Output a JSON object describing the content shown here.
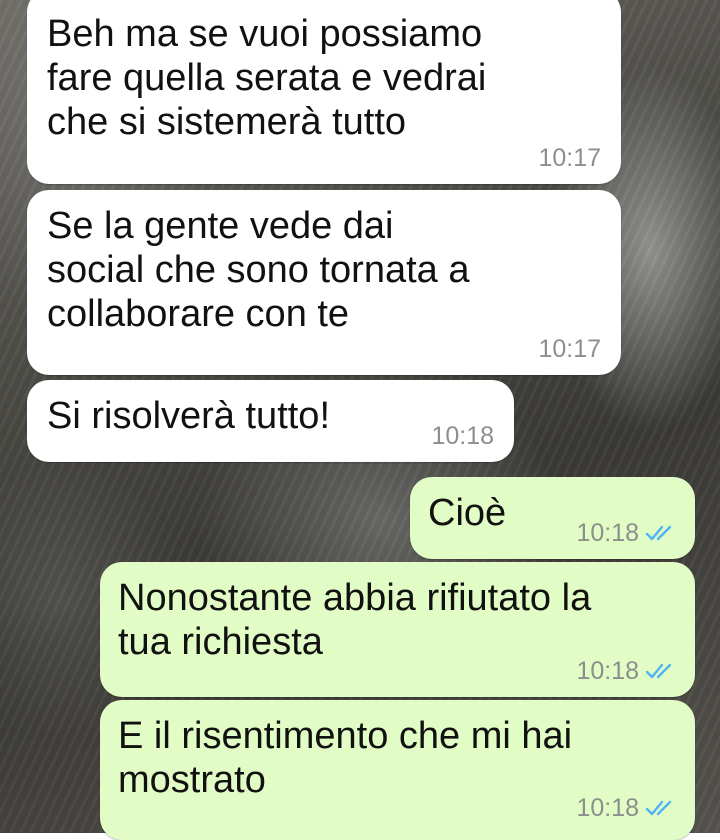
{
  "chat": {
    "messages": [
      {
        "direction": "incoming",
        "text": "Beh ma se vuoi possiamo\nfare quella serata e vedrai\nche si sistemerà tutto",
        "time": "10:17"
      },
      {
        "direction": "incoming",
        "text": "Se la gente vede dai\nsocial che sono tornata a\ncollaborare con te",
        "time": "10:17"
      },
      {
        "direction": "incoming",
        "text": "Si risolverà tutto!",
        "time": "10:18"
      },
      {
        "direction": "outgoing",
        "text": "Cioè",
        "time": "10:18",
        "status_icon": "double-check-read-icon"
      },
      {
        "direction": "outgoing",
        "text": "Nonostante abbia rifiutato la\ntua richiesta",
        "time": "10:18",
        "status_icon": "double-check-read-icon"
      },
      {
        "direction": "outgoing",
        "text": "E il risentimento che mi hai\nmostrato",
        "time": "10:18",
        "status_icon": "double-check-read-icon"
      }
    ]
  },
  "colors": {
    "incoming_bubble": "#ffffff",
    "outgoing_bubble": "#e2fcc6",
    "timestamp": "#8c8f8c",
    "read_ticks": "#4fb3f4"
  }
}
